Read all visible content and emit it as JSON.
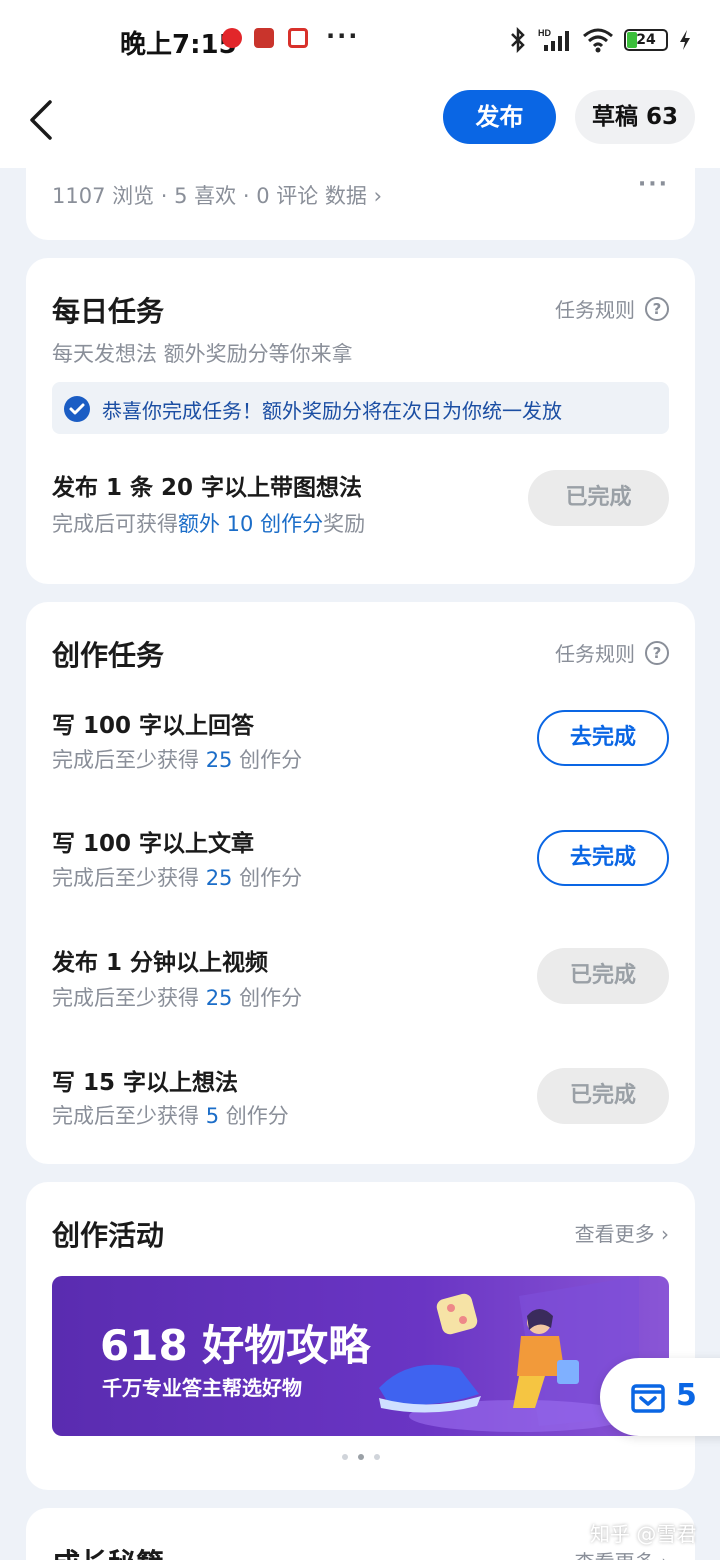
{
  "status_bar": {
    "time": "晚上7:15",
    "dots": "···",
    "battery": "24"
  },
  "header": {
    "publish_label": "发布",
    "draft_label": "草稿 63"
  },
  "post_stats": {
    "text": "1107 浏览 · 5 喜欢 · 0 评论   数据 ›",
    "more": "···"
  },
  "daily_tasks": {
    "title": "每日任务",
    "rules_label": "任务规则",
    "subtitle": "每天发想法 额外奖励分等你来拿",
    "notice": "恭喜你完成任务！额外奖励分将在次日为你统一发放",
    "task": {
      "title": "发布 1 条 20 字以上带图想法",
      "sub_prefix": "完成后可获得",
      "sub_highlight": "额外 10 创作分",
      "sub_suffix": "奖励",
      "button": "已完成"
    }
  },
  "creation_tasks": {
    "title": "创作任务",
    "rules_label": "任务规则",
    "tasks": [
      {
        "title": "写 100 字以上回答",
        "sub_prefix": "完成后至少获得 ",
        "points": "25",
        "sub_suffix": " 创作分",
        "button": "去完成",
        "status": "todo"
      },
      {
        "title": "写 100 字以上文章",
        "sub_prefix": "完成后至少获得 ",
        "points": "25",
        "sub_suffix": " 创作分",
        "button": "去完成",
        "status": "todo"
      },
      {
        "title": "发布 1 分钟以上视频",
        "sub_prefix": "完成后至少获得 ",
        "points": "25",
        "sub_suffix": " 创作分",
        "button": "已完成",
        "status": "done"
      },
      {
        "title": "写 15 字以上想法",
        "sub_prefix": "完成后至少获得 ",
        "points": "5",
        "sub_suffix": " 创作分",
        "button": "已完成",
        "status": "done"
      }
    ]
  },
  "activities": {
    "title": "创作活动",
    "see_more": "查看更多 ›",
    "banner_title": "618 好物攻略",
    "banner_sub": "千万专业答主帮选好物"
  },
  "growth": {
    "title": "成长秘籍",
    "see_more": "查看更多 ›"
  },
  "float_badge": {
    "count": "5"
  },
  "watermark": "知乎 @雪君",
  "colors": {
    "accent": "#0a66e4",
    "highlight": "#1b6dc8",
    "banner": "#5a2cb0"
  }
}
